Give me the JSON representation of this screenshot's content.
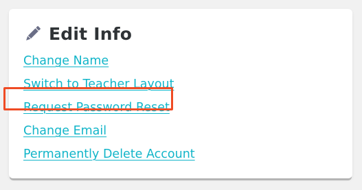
{
  "card": {
    "title": "Edit Info",
    "icon": "pencil-icon",
    "links": [
      "Change Name",
      "Switch to Teacher Layout",
      "Request Password Reset",
      "Change Email",
      "Permanently Delete Account"
    ]
  },
  "colors": {
    "link": "#12b5c9",
    "title": "#2f3336",
    "highlight": "#ef4b24",
    "icon": "#6a6e86"
  },
  "highlighted_link_index": 2
}
